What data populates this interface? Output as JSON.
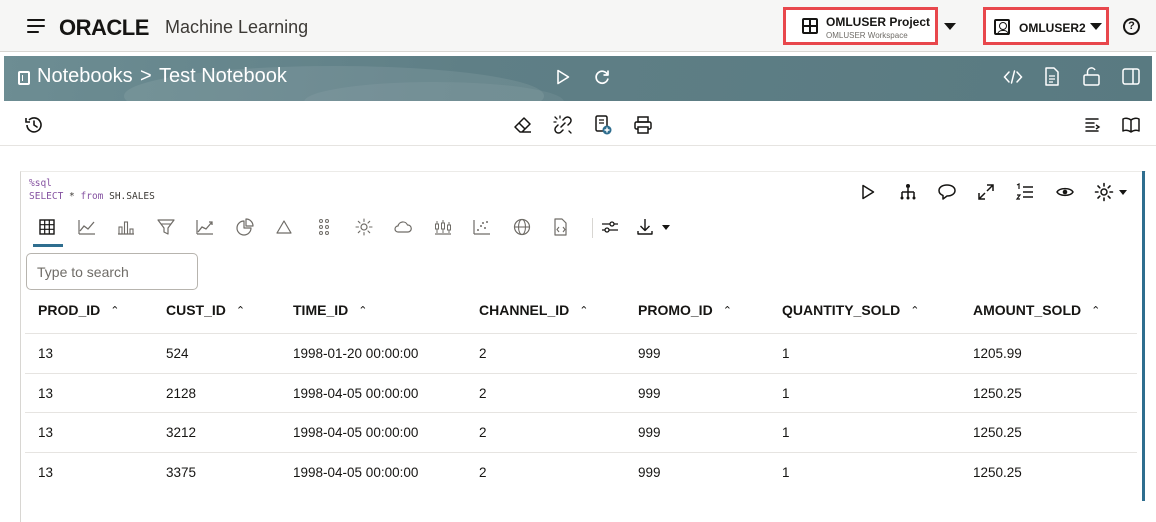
{
  "header": {
    "brand": "ORACLE",
    "app_name": "Machine Learning",
    "project": {
      "title": "OMLUSER Project",
      "workspace": "OMLUSER Workspace"
    },
    "user": "OMLUSER2",
    "help_glyph": "?"
  },
  "banner": {
    "breadcrumb": {
      "root": "Notebooks",
      "separator": ">",
      "current": "Test Notebook"
    },
    "accent_color": "#5f7f86"
  },
  "cell": {
    "code": {
      "magic": "%sql",
      "line2_kw1": "SELECT",
      "line2_rest1": " * ",
      "line2_kw2": "from",
      "line2_rest2": " SH.SALES"
    },
    "search": {
      "placeholder": "Type to search",
      "value": ""
    },
    "viz_icons": [
      "table-icon",
      "line-chart-icon",
      "bar-chart-icon",
      "funnel-icon",
      "area-chart-icon",
      "pie-chart-icon",
      "pyramid-icon",
      "scatter-dots-icon",
      "sun-icon",
      "cloud-icon",
      "box-plot-icon",
      "scatter-plot-icon",
      "globe-icon",
      "code-file-icon",
      "settings-sliders-icon",
      "download-icon"
    ],
    "table": {
      "columns": [
        "PROD_ID",
        "CUST_ID",
        "TIME_ID",
        "CHANNEL_ID",
        "PROMO_ID",
        "QUANTITY_SOLD",
        "AMOUNT_SOLD"
      ],
      "sort_glyph": "⌃⌄",
      "rows": [
        [
          "13",
          "524",
          "1998-01-20 00:00:00",
          "2",
          "999",
          "1",
          "1205.99"
        ],
        [
          "13",
          "2128",
          "1998-04-05 00:00:00",
          "2",
          "999",
          "1",
          "1250.25"
        ],
        [
          "13",
          "3212",
          "1998-04-05 00:00:00",
          "2",
          "999",
          "1",
          "1250.25"
        ],
        [
          "13",
          "3375",
          "1998-04-05 00:00:00",
          "2",
          "999",
          "1",
          "1250.25"
        ]
      ]
    }
  },
  "colors": {
    "highlight": "#e8474c",
    "cell_accent": "#2f6e8f",
    "sql_keyword": "#8552a1"
  }
}
